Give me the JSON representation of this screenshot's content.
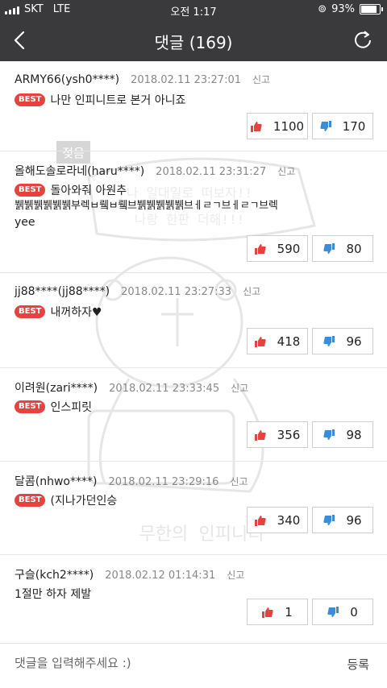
{
  "status_bar": {
    "carrier": "SKT",
    "network": "LTE",
    "time": "오전 1:17",
    "battery": "93%",
    "battery_level": 0.93
  },
  "header": {
    "title": "댓글 (169)"
  },
  "comments": [
    {
      "nick": "ARMY66(ysh0****)",
      "date": "2018.02.11 23:27:01",
      "report": "신고",
      "best": "BEST",
      "text": "나만 인피니트로 본거 아니죠",
      "extra": [],
      "likes": "1100",
      "dislikes": "170"
    },
    {
      "nick": "올해도솔로라네(haru****)",
      "date": "2018.02.11 23:31:27",
      "report": "신고",
      "best": "BEST",
      "text": "돌아와줘 아원추",
      "extra": [
        "뷁뷁뷁뷁뷁뷁부렉ㅂ뤸ㅂ뤸브뷁뷁뷁뷁뷁브ㅔㄹㄱ브ㅔㄹㄱ브렉",
        "yee"
      ],
      "likes": "590",
      "dislikes": "80"
    },
    {
      "nick": "jj88****(jj88****)",
      "date": "2018.02.11 23:27:33",
      "report": "신고",
      "best": "BEST",
      "text": "내꺼하자♥",
      "extra": [],
      "likes": "418",
      "dislikes": "96"
    },
    {
      "nick": "이려원(zari****)",
      "date": "2018.02.11 23:33:45",
      "report": "신고",
      "best": "BEST",
      "text": "인스피릿",
      "extra": [],
      "likes": "356",
      "dislikes": "98"
    },
    {
      "nick": "달콤(nhwo****)",
      "date": "2018.02.11 23:29:16",
      "report": "신고",
      "best": "BEST",
      "text": "(지나가던인승",
      "extra": [],
      "likes": "340",
      "dislikes": "96"
    },
    {
      "nick": "구슬(kch2****)",
      "date": "2018.02.12 01:14:31",
      "report": "신고",
      "best": "",
      "text": "1절만 하자 제발",
      "extra": [],
      "likes": "1",
      "dislikes": "0"
    }
  ],
  "watermark": {
    "top_label": "젖음",
    "line1": "나 일대일로 떠보자!!",
    "line2": "나랑 한판 더해!!!",
    "bottom": "무한의 인피니티"
  },
  "input": {
    "placeholder": "댓글을 입력해주세요 :)"
  },
  "submit_label": "등록",
  "colors": {
    "bar": "#3a3a3c",
    "best": "#e8423e",
    "like": "#e8423e",
    "dislike": "#3a8ed8"
  }
}
